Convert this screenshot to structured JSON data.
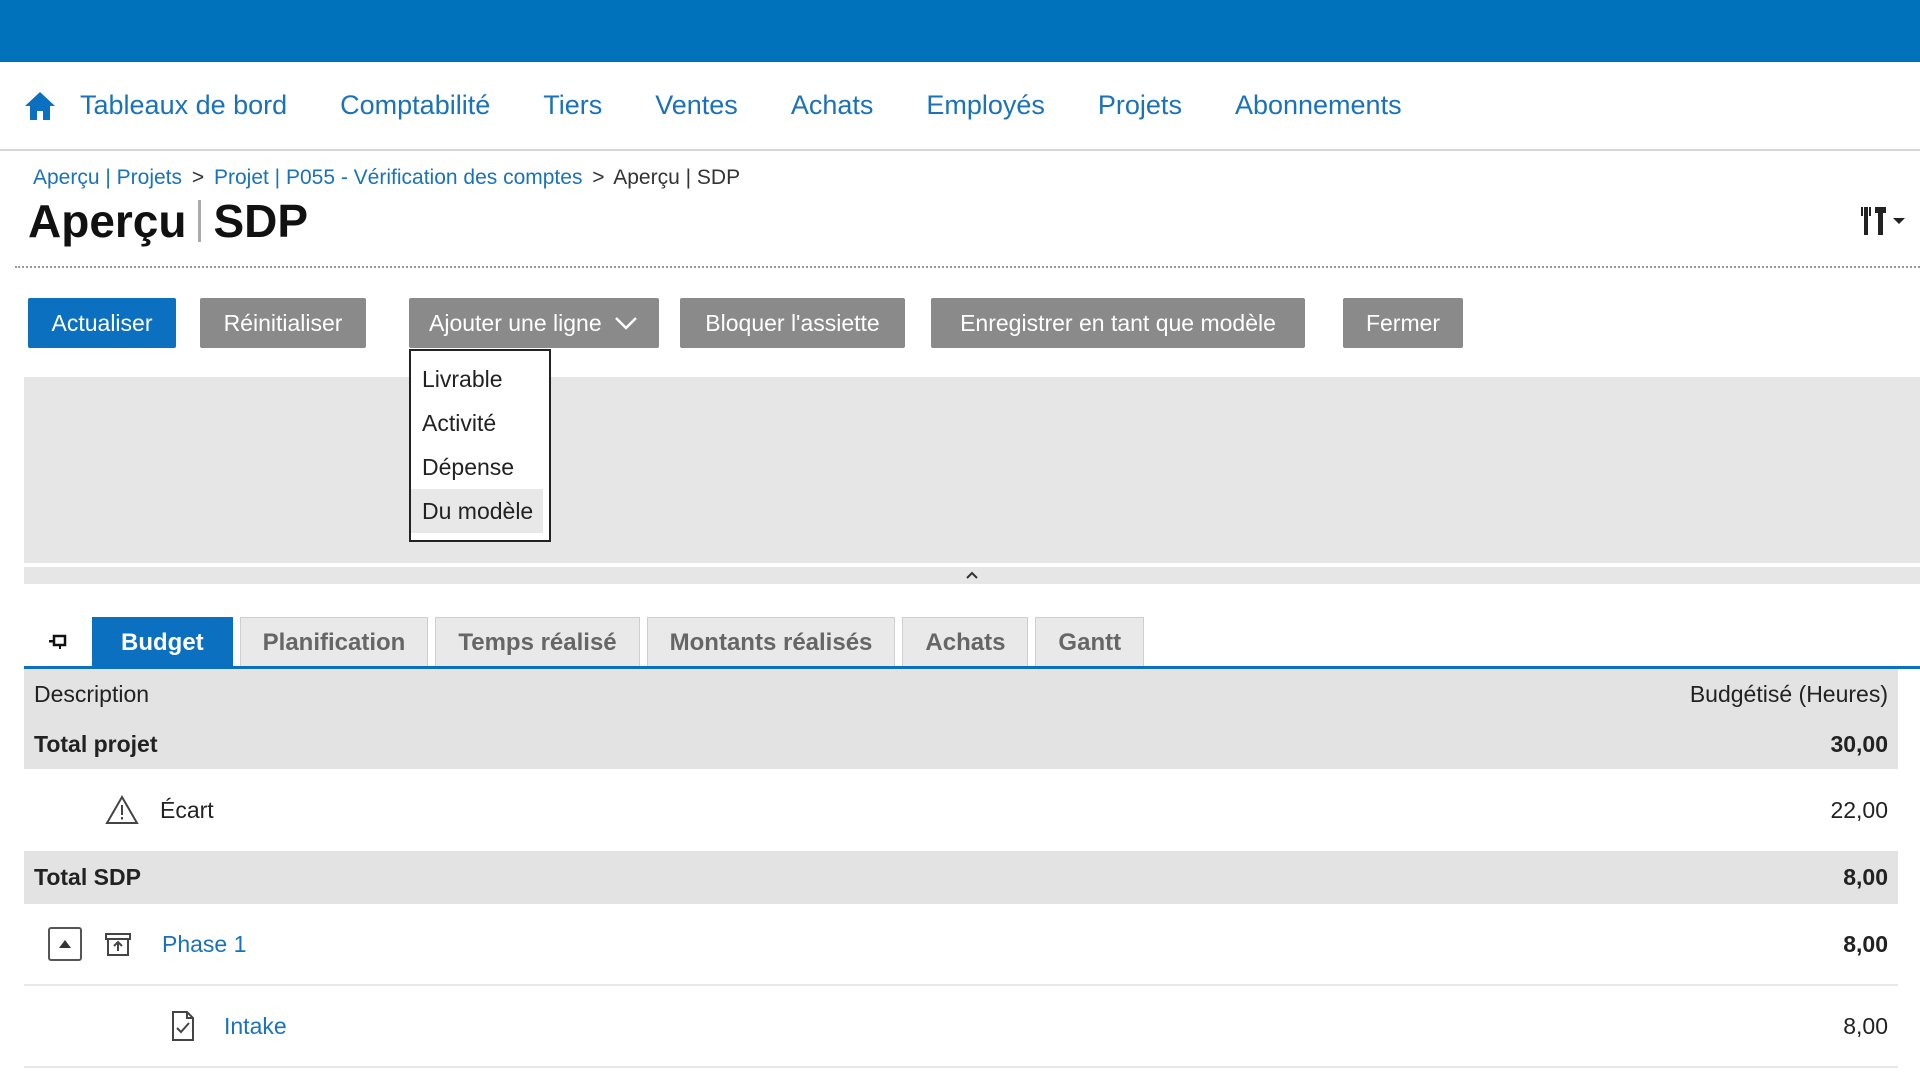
{
  "nav": {
    "home_icon": "home-icon",
    "items": [
      "Tableaux de bord",
      "Comptabilité",
      "Tiers",
      "Ventes",
      "Achats",
      "Employés",
      "Projets",
      "Abonnements"
    ]
  },
  "breadcrumb": {
    "items": [
      {
        "label": "Aperçu | Projets",
        "link": true
      },
      {
        "label": "Projet | P055 - Vérification des comptes",
        "link": true
      },
      {
        "label": "Aperçu | SDP",
        "link": false
      }
    ],
    "separator": ">"
  },
  "page": {
    "title_part1": "Aperçu",
    "title_part2": "SDP",
    "settings_icon": "tools-icon"
  },
  "toolbar": {
    "refresh": "Actualiser",
    "reset": "Réinitialiser",
    "add_line": "Ajouter une ligne",
    "lock": "Bloquer l'assiette",
    "save_template": "Enregistrer en tant que modèle",
    "close": "Fermer"
  },
  "add_line_menu": {
    "options": [
      "Livrable",
      "Activité",
      "Dépense",
      "Du modèle"
    ],
    "hovered": "Du modèle"
  },
  "tabs": {
    "items": [
      "Budget",
      "Planification",
      "Temps réalisé",
      "Montants réalisés",
      "Achats",
      "Gantt"
    ],
    "active": "Budget"
  },
  "table": {
    "columns": [
      "Description",
      "Budgétisé (Heures)"
    ],
    "rows": [
      {
        "type": "total",
        "label": "Total projet",
        "value": "30,00"
      },
      {
        "type": "variance",
        "label": "Écart",
        "value": "22,00",
        "icon": "warning-icon"
      },
      {
        "type": "total",
        "label": "Total SDP",
        "value": "8,00"
      },
      {
        "type": "deliverable",
        "label": "Phase 1",
        "value": "8,00",
        "icon": "deliverable-icon"
      },
      {
        "type": "activity",
        "label": "Intake",
        "value": "8,00",
        "icon": "activity-icon"
      }
    ]
  },
  "colors": {
    "brand": "#0072bc",
    "link": "#1a72b8",
    "button_primary": "#0a70bf",
    "button_secondary": "#8a8a8a"
  }
}
